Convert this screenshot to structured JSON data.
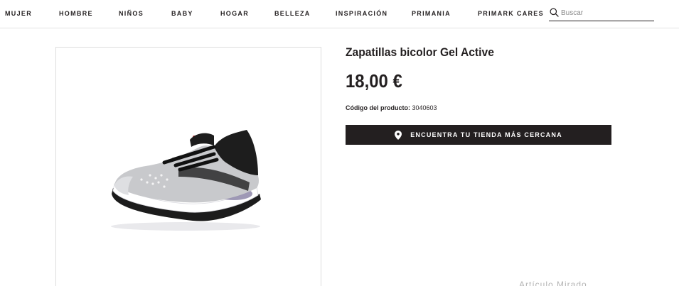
{
  "nav": {
    "items": [
      {
        "label": "MUJER"
      },
      {
        "label": "HOMBRE"
      },
      {
        "label": "NIÑOS"
      },
      {
        "label": "BABY"
      },
      {
        "label": "HOGAR"
      },
      {
        "label": "BELLEZA"
      },
      {
        "label": "INSPIRACIÓN"
      },
      {
        "label": "PRIMANIA"
      },
      {
        "label": "PRIMARK CARES"
      }
    ],
    "search": {
      "placeholder": "Buscar",
      "icon": "search-icon"
    }
  },
  "product": {
    "title": "Zapatillas bicolor Gel Active",
    "price": "18,00 €",
    "code_label": "Código del producto:",
    "code_value": "3040603",
    "image": {
      "icon": "sneaker-image",
      "colors": {
        "upper": "#c9cacc",
        "trim": "#1d1d1d",
        "accent": "#d12d2d",
        "sole": "#ffffff"
      }
    }
  },
  "cta": {
    "label": "ENCUENTRA TU TIENDA MÁS CERCANA",
    "icon": "location-pin-icon"
  },
  "footer_partial": {
    "text": "Artículo Mirado"
  },
  "colors": {
    "brand_dark": "#231f20",
    "border": "#dddddd"
  }
}
